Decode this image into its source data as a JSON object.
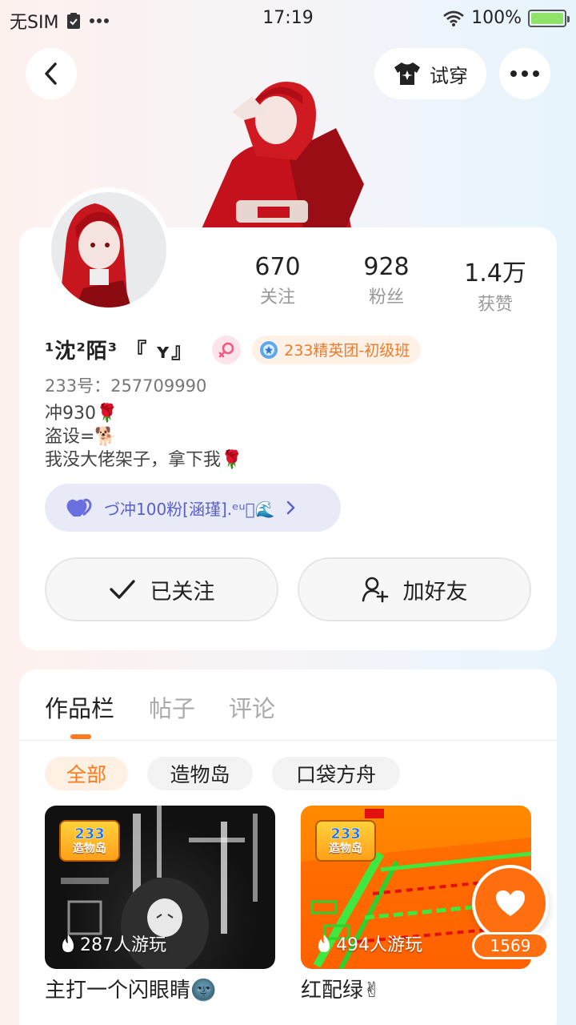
{
  "status_bar": {
    "carrier": "无SIM",
    "time": "17:19",
    "battery": "100%"
  },
  "header": {
    "try_on_label": "试穿"
  },
  "stats": [
    {
      "value": "670",
      "label": "关注"
    },
    {
      "value": "928",
      "label": "粉丝"
    },
    {
      "value": "1.4万",
      "label": "获赞"
    }
  ],
  "profile": {
    "name": "¹沈²陌³ 『 ʏ』",
    "badge": "233精英团-初级班",
    "uid": "233号：257709990",
    "bio": [
      "冲930🌹",
      "盗设=🐕",
      "我没大佬架子，拿下我🌹"
    ],
    "group": "づ冲100粉[涵瑾].ᵉᵘ⃝🌊"
  },
  "actions": {
    "followed_label": "已关注",
    "add_friend_label": "加好友"
  },
  "tabs": [
    {
      "label": "作品栏",
      "active": true
    },
    {
      "label": "帖子",
      "active": false
    },
    {
      "label": "评论",
      "active": false
    }
  ],
  "filters": [
    {
      "label": "全部",
      "active": true
    },
    {
      "label": "造物岛",
      "active": false
    },
    {
      "label": "口袋方舟",
      "active": false
    }
  ],
  "works": [
    {
      "title": "主打一个闪眼睛🌚",
      "plays": "287人游玩",
      "logo_top": "233",
      "logo_bottom": "造物岛"
    },
    {
      "title": "红配绿✌",
      "plays": "494人游玩",
      "logo_top": "233",
      "logo_bottom": "造物岛"
    }
  ],
  "like": {
    "count": "1569"
  },
  "colors": {
    "accent": "#ff7a1a",
    "badge_text": "#f07a2a",
    "group_text": "#5a5fc8"
  }
}
